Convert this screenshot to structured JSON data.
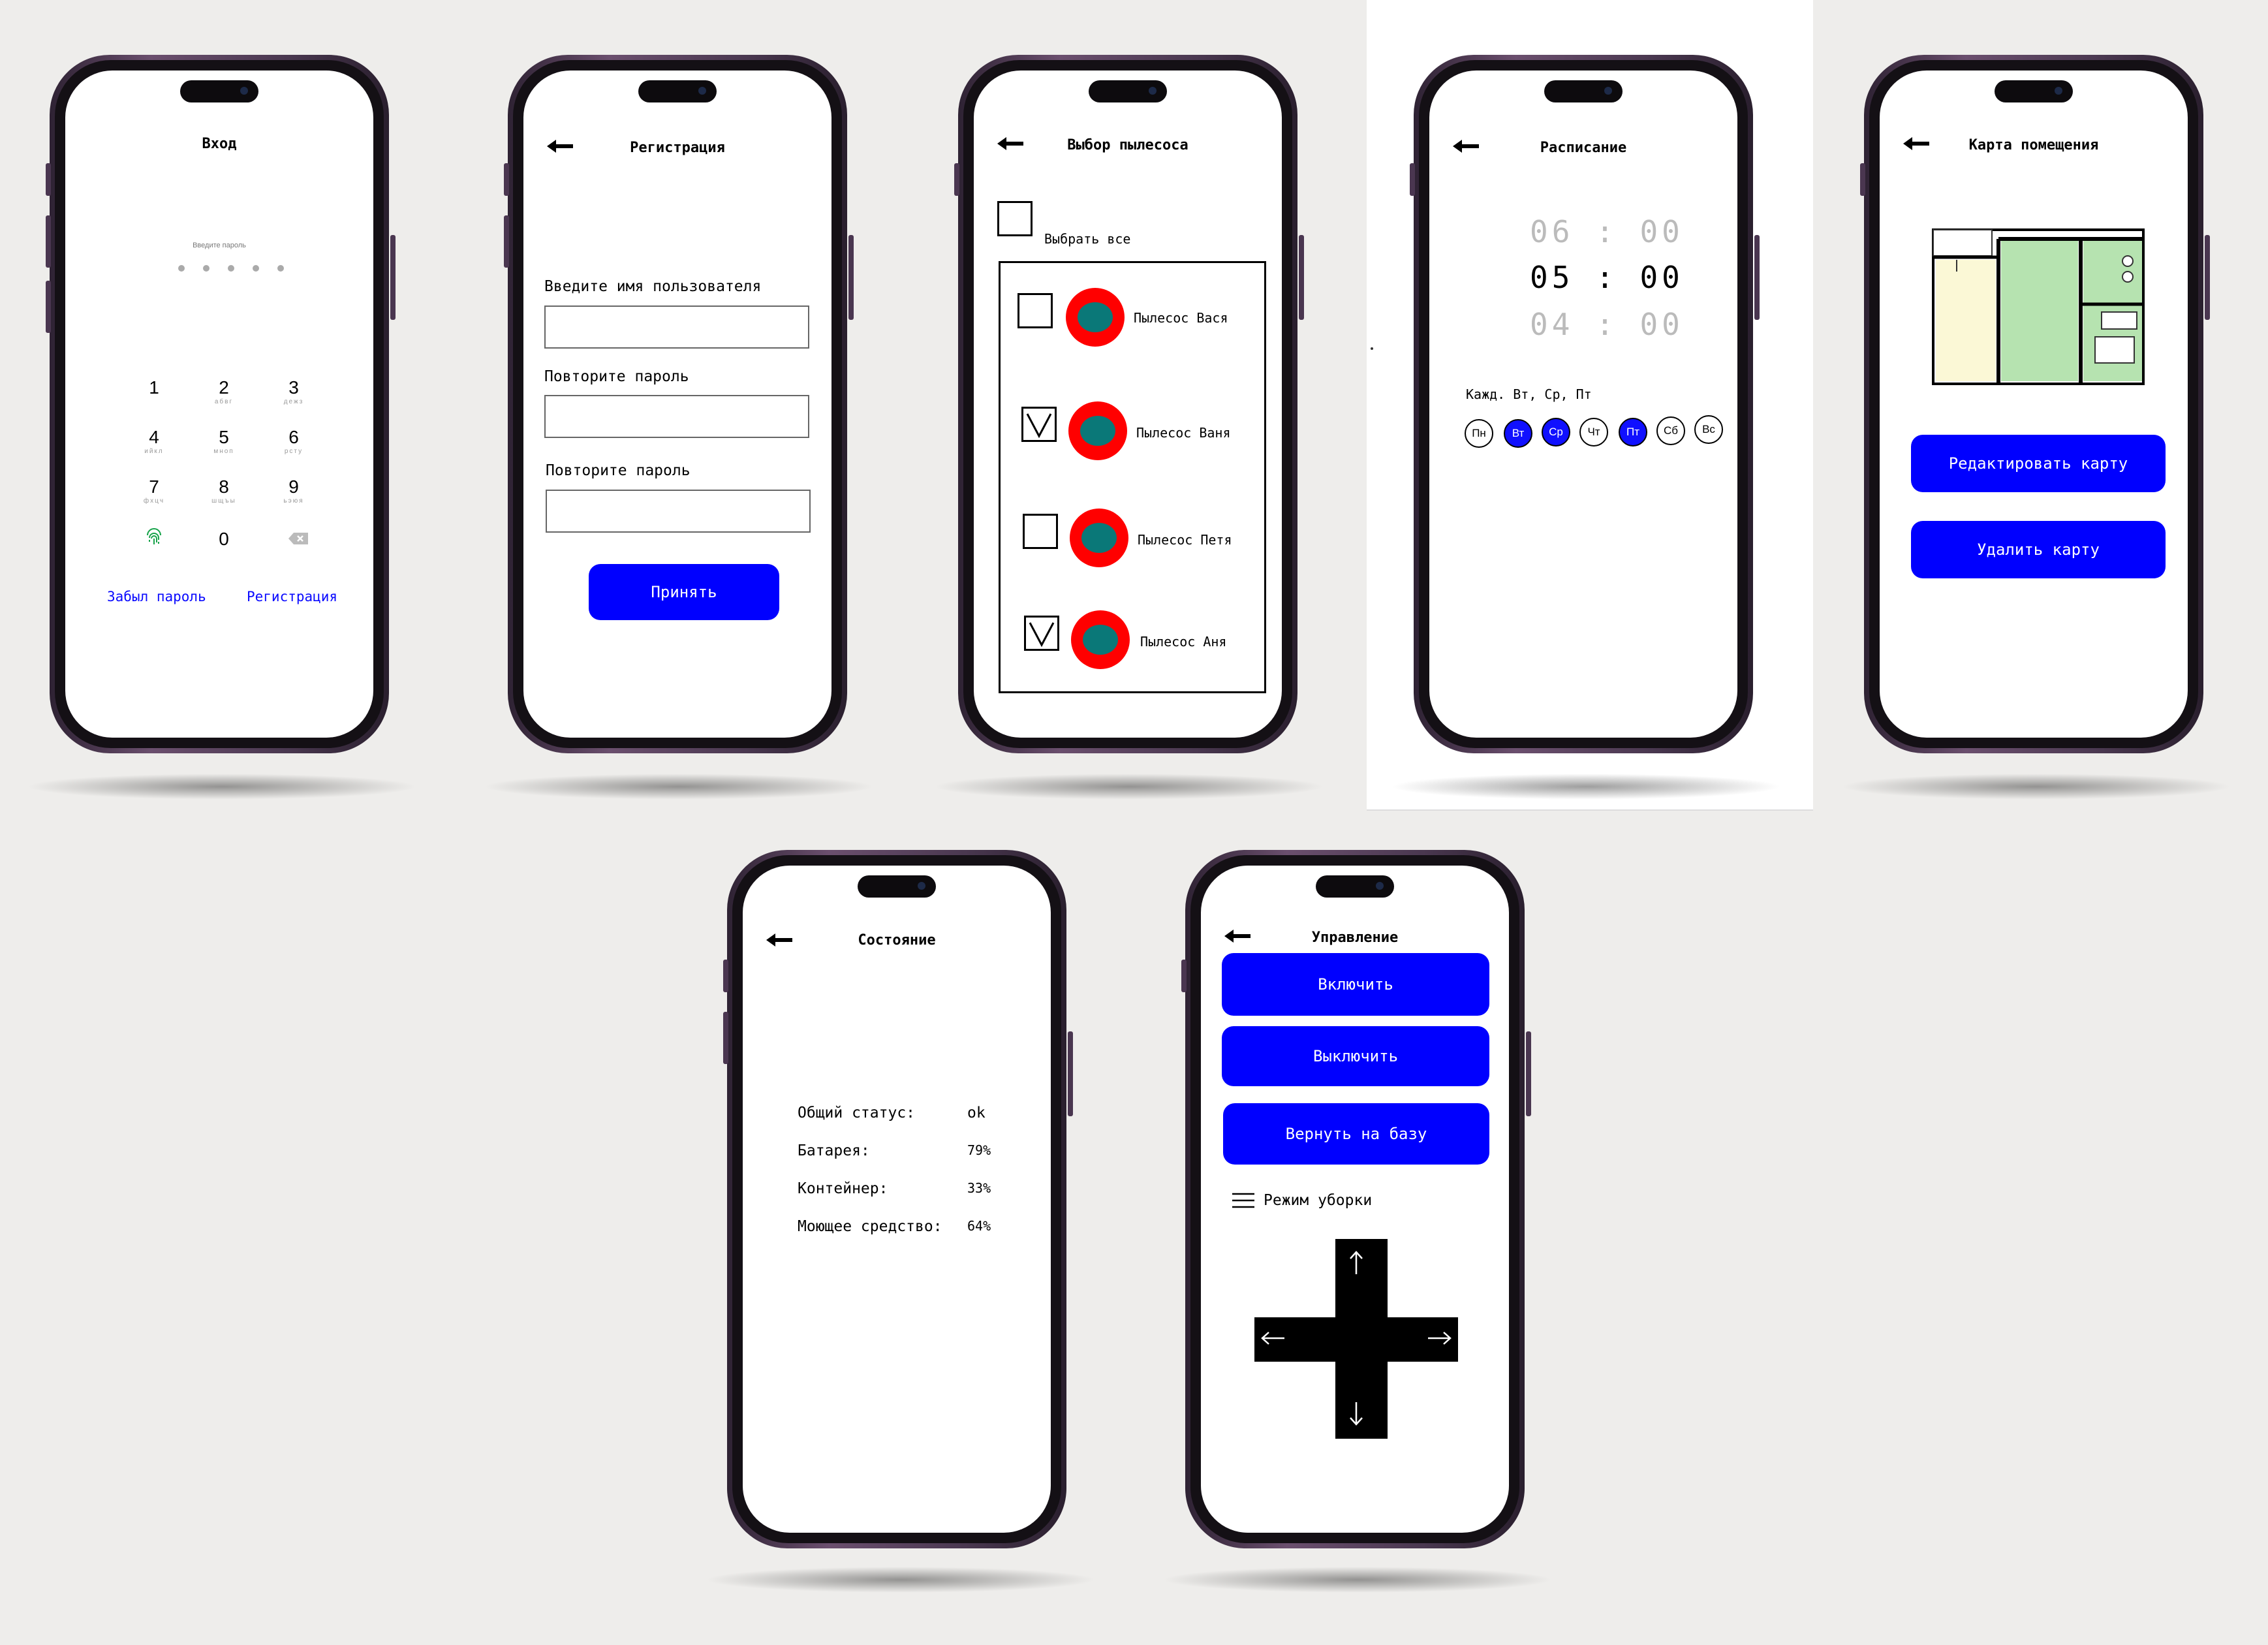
{
  "login": {
    "title": "Вход",
    "pin_hint": "Введите пароль",
    "keys": [
      {
        "num": "1",
        "letters": ""
      },
      {
        "num": "2",
        "letters": "абвг"
      },
      {
        "num": "3",
        "letters": "дежз"
      },
      {
        "num": "4",
        "letters": "ийкл"
      },
      {
        "num": "5",
        "letters": "мноп"
      },
      {
        "num": "6",
        "letters": "рсту"
      },
      {
        "num": "7",
        "letters": "фхцч"
      },
      {
        "num": "8",
        "letters": "шщъы"
      },
      {
        "num": "9",
        "letters": "ьэюя"
      },
      {
        "num": "0",
        "letters": ""
      }
    ],
    "forgot": "Забыл пароль",
    "register": "Регистрация"
  },
  "registration": {
    "title": "Регистрация",
    "label_username": "Введите имя пользователя",
    "label_repeat1": "Повторите пароль",
    "label_repeat2": "Повторите пароль",
    "accept": "Принять"
  },
  "vacuum_select": {
    "title": "Выбор пылесоса",
    "select_all": "Выбрать все",
    "items": [
      {
        "name": "Пылесос Вася",
        "checked": false
      },
      {
        "name": "Пылесос Ваня",
        "checked": true
      },
      {
        "name": "Пылесос Петя",
        "checked": false
      },
      {
        "name": "Пылесос Аня",
        "checked": true
      }
    ]
  },
  "schedule": {
    "title": "Расписание",
    "times": [
      {
        "h": "06",
        "m": "00"
      },
      {
        "h": "05",
        "m": "00"
      },
      {
        "h": "04",
        "m": "00"
      }
    ],
    "repeat": "Кажд. Вт, Ср, Пт",
    "days": [
      {
        "label": "Пн",
        "on": false
      },
      {
        "label": "Вт",
        "on": true
      },
      {
        "label": "Ср",
        "on": true
      },
      {
        "label": "Чт",
        "on": false
      },
      {
        "label": "Пт",
        "on": true
      },
      {
        "label": "Сб",
        "on": false
      },
      {
        "label": "Вс",
        "on": false
      }
    ]
  },
  "map": {
    "title": "Карта помещения",
    "edit": "Редактировать карту",
    "delete": "Удалить карту"
  },
  "status": {
    "title": "Состояние",
    "rows": [
      {
        "label": "Общий статус:",
        "value": "ok"
      },
      {
        "label": "Батарея:",
        "value": "79%"
      },
      {
        "label": "Контейнер:",
        "value": "33%"
      },
      {
        "label": "Моющее средство:",
        "value": "64%"
      }
    ]
  },
  "control": {
    "title": "Управление",
    "on": "Включить",
    "off": "Выключить",
    "home": "Вернуть на базу",
    "mode": "Режим уборки"
  },
  "colors": {
    "accent": "#0000ff",
    "robot_body": "#ff0000",
    "robot_top": "#0a7878",
    "day_on": "#1010ff"
  }
}
